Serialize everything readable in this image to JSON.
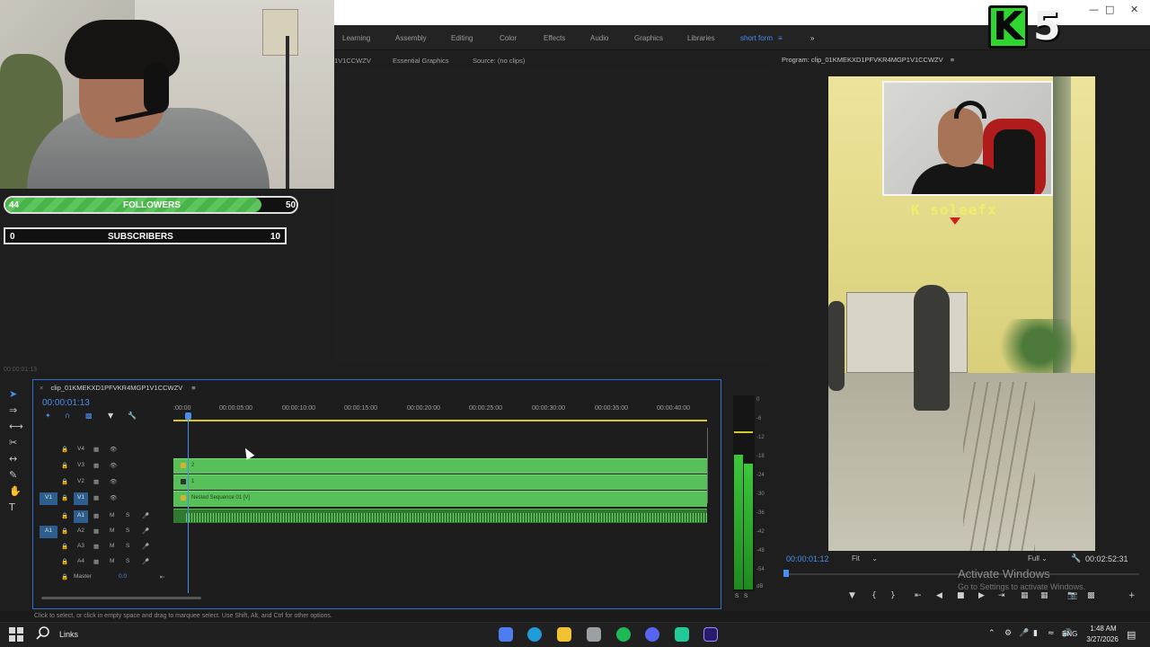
{
  "workspaces": [
    "Learning",
    "Assembly",
    "Editing",
    "Color",
    "Effects",
    "Audio",
    "Graphics",
    "Libraries",
    "short form"
  ],
  "workspace_menu": "≡",
  "workspace_more": "»",
  "window_controls": {
    "minimize": "—",
    "maximize": "□",
    "close": "✕"
  },
  "overlay": {
    "logo_k": "K",
    "logo_5": "5",
    "followers": {
      "current": "44",
      "label": "FOLLOWERS",
      "goal": "50",
      "progress": 0.88
    },
    "subscribers": {
      "current": "0",
      "label": "SUBSCRIBERS",
      "goal": "10",
      "progress": 0.0
    }
  },
  "source_panel": {
    "tabs": [
      "1V1CCWZV",
      "Essential Graphics",
      "Source: (no clips)"
    ]
  },
  "source_timecode": "00:00:01:13",
  "program": {
    "title": "Program: clip_01KMEKXD1PFVKR4MGP1V1CCWZV",
    "menu_icon": "≡",
    "timecode": "00:00:01:12",
    "fit": "Fit",
    "resolution": "Full",
    "duration": "00:02:52:31",
    "streamer_name": "K soleefx"
  },
  "timeline": {
    "sequence_name": "clip_01KMEKXD1PFVKR4MGP1V1CCWZV",
    "menu_icon": "≡",
    "timecode": "00:00:01:13",
    "ruler": [
      ":00:00",
      "00:00:05:00",
      "00:00:10:00",
      "00:00:15:00",
      "00:00:20:00",
      "00:00:25:00",
      "00:00:30:00",
      "00:00:35:00",
      "00:00:40:00"
    ],
    "video_tracks": [
      {
        "source": "",
        "name": "V4",
        "on": false
      },
      {
        "source": "",
        "name": "V3",
        "on": false
      },
      {
        "source": "",
        "name": "V2",
        "on": false
      },
      {
        "source": "V1",
        "name": "V1",
        "on": true
      }
    ],
    "audio_tracks": [
      {
        "source": "",
        "name": "A1",
        "on": true
      },
      {
        "source": "A1",
        "name": "A2",
        "on": false
      },
      {
        "source": "",
        "name": "A3",
        "on": false
      },
      {
        "source": "",
        "name": "A4",
        "on": false
      }
    ],
    "clips": {
      "v3": "2",
      "v2": "1",
      "v1": "Nested Sequence 01 [V]"
    },
    "master_label": "Master",
    "master_value": "0.0",
    "track_toggles": {
      "mute": "M",
      "solo": "S"
    }
  },
  "meter": {
    "scale": [
      "0",
      "-6",
      "-12",
      "-18",
      "-24",
      "-30",
      "-36",
      "-42",
      "-48",
      "-54",
      "dB"
    ],
    "solo_left": "S",
    "solo_right": "S"
  },
  "status_text": "Click to select, or click in empty space and drag to marquee select. Use Shift, Alt, and Ctrl for other options.",
  "activate": {
    "title": "Activate Windows",
    "subtitle": "Go to Settings to activate Windows."
  },
  "taskbar": {
    "search_label": "Links",
    "lang": "ENG",
    "time": "1:48 AM",
    "date": "3/27/2026",
    "apps": [
      {
        "name": "copilot",
        "color": "#4f7df0"
      },
      {
        "name": "edge",
        "color": "#1f9bd8"
      },
      {
        "name": "explorer",
        "color": "#f1c232"
      },
      {
        "name": "store",
        "color": "#9aa0a6"
      },
      {
        "name": "spotify",
        "color": "#1db954"
      },
      {
        "name": "discord",
        "color": "#5865f2"
      },
      {
        "name": "capcut",
        "color": "#20c997"
      },
      {
        "name": "premiere",
        "color": "#2a1b6e"
      }
    ]
  }
}
